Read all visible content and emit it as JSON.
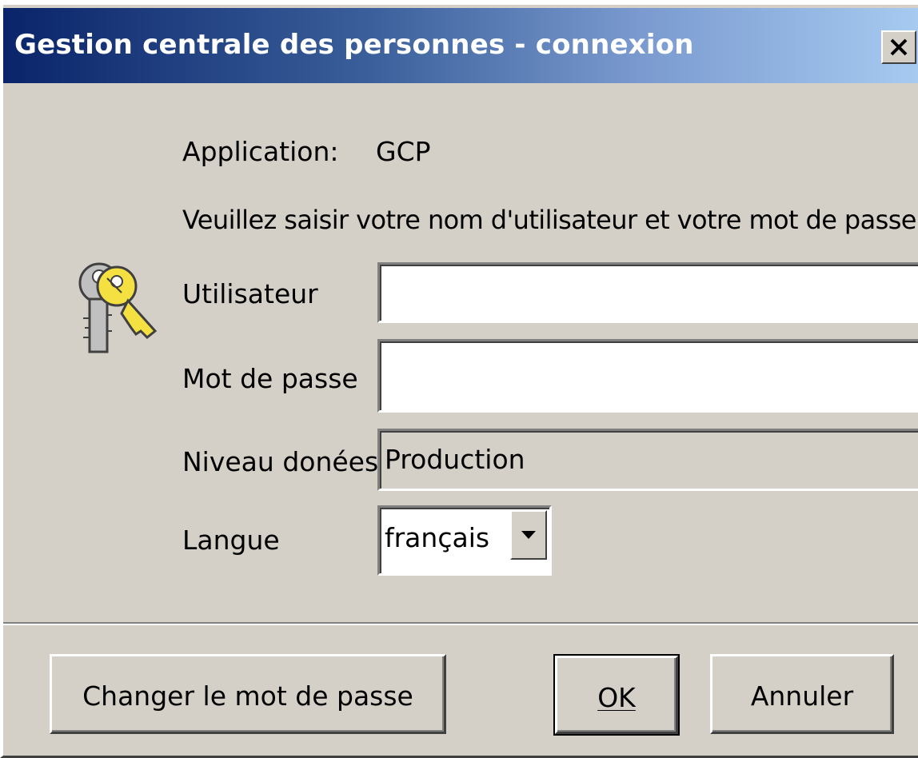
{
  "window": {
    "title": "Gestion centrale des personnes - connexion",
    "close_icon": "close-icon"
  },
  "form": {
    "application_label": "Application:",
    "application_value": "GCP",
    "instruction": "Veuillez saisir votre nom d'utilisateur et votre mot de passe.",
    "user_label": "Utilisateur",
    "user_value": "",
    "password_label": "Mot de passe",
    "password_value": "",
    "data_level_label": "Niveau donées",
    "data_level_value": "Production",
    "language_label": "Langue",
    "language_value": "français",
    "icon": "keys-icon"
  },
  "buttons": {
    "change_password": "Changer le mot de passe",
    "ok": "OK",
    "cancel": "Annuler"
  },
  "colors": {
    "title_start": "#0a246a",
    "title_end": "#a6caf0",
    "face": "#d4d0c8"
  }
}
